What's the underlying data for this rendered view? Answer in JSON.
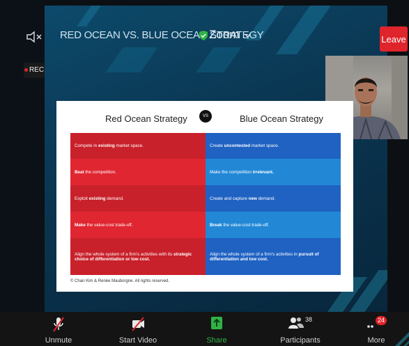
{
  "meeting": {
    "title": "RED OCEAN VS. BLUE OCEAN STRATEGY",
    "zoom_menu": "Zoom",
    "leave_label": "Leave",
    "rec_label": "REC"
  },
  "slide": {
    "red_header": "Red Ocean Strategy",
    "vs_label": "VS",
    "blue_header": "Blue Ocean Strategy",
    "rows": [
      {
        "red": {
          "pre": "Compete in ",
          "bold": "existing",
          "post": " market space."
        },
        "blue": {
          "pre": "Create ",
          "bold": "uncontested",
          "post": " market space."
        }
      },
      {
        "red": {
          "pre": "",
          "bold": "Beat",
          "post": " the competition."
        },
        "blue": {
          "pre": "Make the competition ",
          "bold": "irrelevant.",
          "post": ""
        }
      },
      {
        "red": {
          "pre": "Exploit ",
          "bold": "existing",
          "post": " demand."
        },
        "blue": {
          "pre": "Create and capture ",
          "bold": "new",
          "post": " demand."
        }
      },
      {
        "red": {
          "pre": "",
          "bold": "Make",
          "post": " the value-cost trade-off."
        },
        "blue": {
          "pre": "",
          "bold": "Break",
          "post": " the value-cost trade-off."
        }
      },
      {
        "red": {
          "pre": "Align the whole system of a firm's activities with its ",
          "bold": "strategic choice of differentiation or low cost.",
          "post": ""
        },
        "blue": {
          "pre": "Align the whole system of a firm's activities in ",
          "bold": "pursuit of differentiation and low cost.",
          "post": ""
        }
      }
    ],
    "copyright": "© Chan Kim & Renée Mauborgne. All rights reserved.",
    "colors": {
      "red_rows": [
        "#c8212b",
        "#e02631",
        "#c8212b",
        "#e02631",
        "#c8212b"
      ],
      "blue_rows": [
        "#1f62c2",
        "#2288d6",
        "#1f62c2",
        "#2288d6",
        "#1f62c2"
      ]
    }
  },
  "toolbar": {
    "unmute_label": "Unmute",
    "start_video_label": "Start Video",
    "share_label": "Share",
    "participants_label": "Participants",
    "participants_count": "38",
    "more_label": "More",
    "more_badge": "24"
  },
  "icons": [
    "speaker-muted-icon",
    "shield-icon",
    "chevron-down-icon",
    "mic-muted-icon",
    "video-off-icon",
    "share-arrow-icon",
    "participants-icon",
    "more-dots-icon"
  ]
}
